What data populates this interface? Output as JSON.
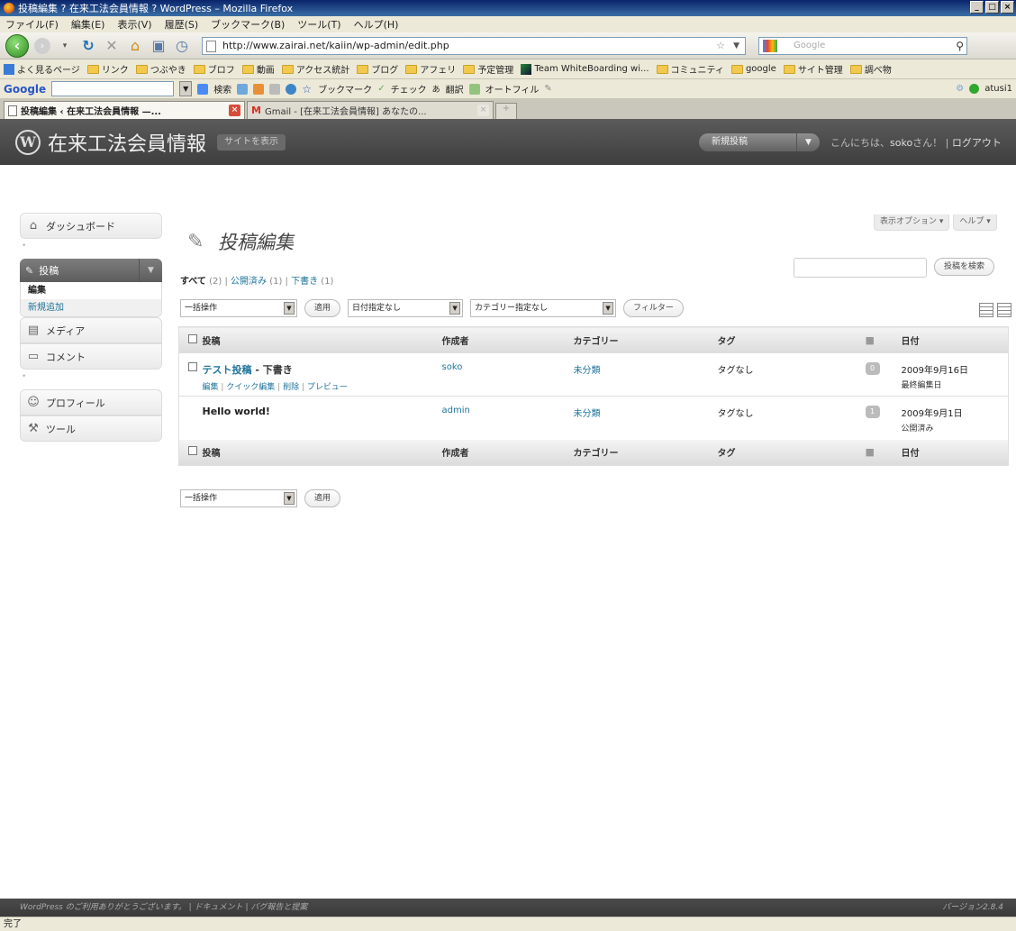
{
  "window": {
    "title": "投稿編集 ? 在来工法会員情報 ? WordPress – Mozilla Firefox"
  },
  "menubar": [
    "ファイル(F)",
    "編集(E)",
    "表示(V)",
    "履歴(S)",
    "ブックマーク(B)",
    "ツール(T)",
    "ヘルプ(H)"
  ],
  "navbar": {
    "url": "http://www.zairai.net/kaiin/wp-admin/edit.php",
    "search_placeholder": "Google"
  },
  "bookmarks": [
    {
      "label": "よく見るページ",
      "icon": "site-icon"
    },
    {
      "label": "リンク",
      "icon": "folder-icon"
    },
    {
      "label": "つぶやき",
      "icon": "folder-icon"
    },
    {
      "label": "ブロフ",
      "icon": "folder-icon"
    },
    {
      "label": "動画",
      "icon": "folder-icon"
    },
    {
      "label": "アクセス統計",
      "icon": "folder-icon"
    },
    {
      "label": "ブログ",
      "icon": "folder-icon"
    },
    {
      "label": "アフェリ",
      "icon": "folder-icon"
    },
    {
      "label": "予定管理",
      "icon": "folder-icon"
    },
    {
      "label": "Team WhiteBoarding wi...",
      "icon": "tw-icon"
    },
    {
      "label": "コミュニティ",
      "icon": "folder-icon"
    },
    {
      "label": "google",
      "icon": "folder-icon"
    },
    {
      "label": "サイト管理",
      "icon": "folder-icon"
    },
    {
      "label": "調べ物",
      "icon": "folder-icon"
    }
  ],
  "google_toolbar": {
    "logo": "Google",
    "search": "検索",
    "bookmarks": "ブックマーク",
    "check": "チェック",
    "translate": "翻訳",
    "autofill": "オートフィル",
    "user": "atusi1"
  },
  "tabs": [
    {
      "label": "投稿編集 ‹ 在来工法会員情報 —...",
      "active": true
    },
    {
      "label": "Gmail - [在来工法会員情報] あなたの...",
      "active": false
    }
  ],
  "wp_header": {
    "site_title": "在来工法会員情報",
    "visit_site": "サイトを表示",
    "favorite": "新規投稿",
    "howdy_prefix": "こんにちは、",
    "user": "soko",
    "howdy_suffix": "さん！ | ",
    "logout": "ログアウト"
  },
  "sidebar": {
    "dashboard": "ダッシュボード",
    "posts": "投稿",
    "posts_edit": "編集",
    "posts_add": "新規追加",
    "media": "メディア",
    "comments": "コメント",
    "profile": "プロフィール",
    "tools": "ツール"
  },
  "screen_options": {
    "display_options": "表示オプション ▾",
    "help": "ヘルプ ▾"
  },
  "main": {
    "page_title": "投稿編集",
    "filters": {
      "all": "すべて",
      "all_count": "(2)",
      "published": "公開済み",
      "published_count": "(1)",
      "drafts": "下書き",
      "drafts_count": "(1)"
    },
    "search_button": "投稿を検索",
    "bulk_action": "一括操作",
    "apply": "適用",
    "date_filter": "日付指定なし",
    "category_filter": "カテゴリー指定なし",
    "filter_button": "フィルター"
  },
  "table": {
    "headers": {
      "title": "投稿",
      "author": "作成者",
      "categories": "カテゴリー",
      "tags": "タグ",
      "date": "日付"
    },
    "rows": [
      {
        "title": "テスト投稿",
        "state": " - 下書き",
        "actions": [
          "編集",
          "クイック編集",
          "削除",
          "プレビュー"
        ],
        "author": "soko",
        "category": "未分類",
        "tags": "タグなし",
        "comments": "0",
        "date": "2009年9月16日",
        "date_status": "最終編集日"
      },
      {
        "title": "Hello world!",
        "state": "",
        "author": "admin",
        "category": "未分類",
        "tags": "タグなし",
        "comments": "1",
        "date": "2009年9月1日",
        "date_status": "公開済み"
      }
    ]
  },
  "footer": {
    "thanks": "WordPress のご利用ありがとうございます。 | ドキュメント | バグ報告と提案",
    "version": "バージョン2.8.4"
  },
  "statusbar": {
    "text": "完了"
  }
}
